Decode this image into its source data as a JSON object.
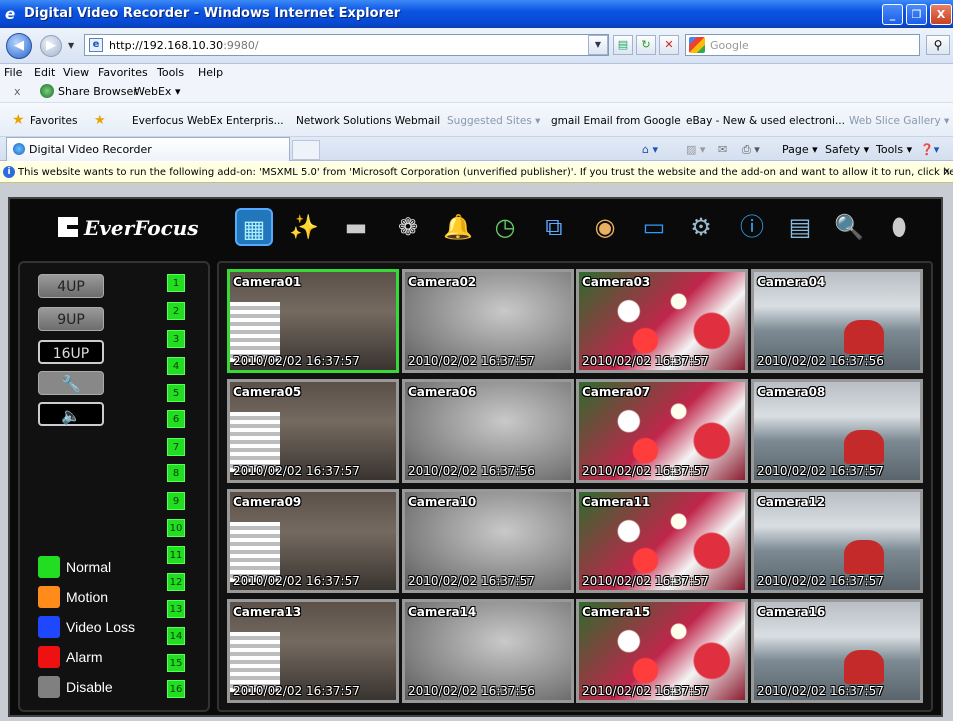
{
  "window": {
    "title": "Digital Video Recorder - Windows Internet Explorer",
    "buttons": {
      "minimize": "_",
      "maximize": "❐",
      "close": "X"
    }
  },
  "address": {
    "url_host": "http://192.168.10.30",
    "url_port": ":9980/",
    "search_placeholder": "Google"
  },
  "menu": [
    "File",
    "Edit",
    "View",
    "Favorites",
    "Tools",
    "Help"
  ],
  "linkbar": {
    "close": "x",
    "share": "Share Browser",
    "webex": "WebEx ▾"
  },
  "favorites": {
    "label": "Favorites",
    "items": [
      "Everfocus WebEx Enterpris...",
      "Network Solutions Webmail",
      "Suggested Sites ▾",
      "gmail Email from Google",
      "eBay - New & used electroni...",
      "Web Slice Gallery ▾"
    ]
  },
  "tab": {
    "label": "Digital Video Recorder"
  },
  "commands": {
    "page": "Page ▾",
    "safety": "Safety ▾",
    "tools": "Tools ▾"
  },
  "infobar": {
    "message": "This website wants to run the following add-on: 'MSXML 5.0' from 'Microsoft Corporation (unverified publisher)'. If you trust the website and the add-on and want to allow it to run, click here..."
  },
  "dvr": {
    "brand": "EverFocus",
    "toolbar_icons": [
      "live-view-icon",
      "magic-wand-icon",
      "camera-icon",
      "film-reel-icon",
      "bell-icon",
      "schedule-icon",
      "network-icon",
      "hdd-icon",
      "monitor-icon",
      "gears-icon",
      "info-icon",
      "film-strip-icon",
      "search-doc-icon",
      "ptz-dome-icon"
    ],
    "layouts": [
      "4UP",
      "9UP",
      "16UP"
    ],
    "channels": [
      "1",
      "2",
      "3",
      "4",
      "5",
      "6",
      "7",
      "8",
      "9",
      "10",
      "11",
      "12",
      "13",
      "14",
      "15",
      "16"
    ],
    "legend": [
      {
        "label": "Normal",
        "color": "#22dd22"
      },
      {
        "label": "Motion",
        "color": "#ff8c1a"
      },
      {
        "label": "Video Loss",
        "color": "#1f47ff"
      },
      {
        "label": "Alarm",
        "color": "#ee1111"
      },
      {
        "label": "Disable",
        "color": "#808080"
      }
    ],
    "cameras": [
      {
        "name": "Camera01",
        "ts": "2010/02/02  16:37:57"
      },
      {
        "name": "Camera02",
        "ts": "2010/02/02  16:37:57"
      },
      {
        "name": "Camera03",
        "ts": "2010/02/02  16:37:57"
      },
      {
        "name": "Camera04",
        "ts": "2010/02/02  16:37:56"
      },
      {
        "name": "Camera05",
        "ts": "2010/02/02  16:37:57"
      },
      {
        "name": "Camera06",
        "ts": "2010/02/02  16:37:56"
      },
      {
        "name": "Camera07",
        "ts": "2010/02/02  16:37:57"
      },
      {
        "name": "Camera08",
        "ts": "2010/02/02  16:37:57"
      },
      {
        "name": "Camera09",
        "ts": "2010/02/02  16:37:57"
      },
      {
        "name": "Camera10",
        "ts": "2010/02/02  16:37:57"
      },
      {
        "name": "Camera11",
        "ts": "2010/02/02  16:37:57"
      },
      {
        "name": "Camera12",
        "ts": "2010/02/02  16:37:57"
      },
      {
        "name": "Camera13",
        "ts": "2010/02/02  16:37:57"
      },
      {
        "name": "Camera14",
        "ts": "2010/02/02  16:37:56"
      },
      {
        "name": "Camera15",
        "ts": "2010/02/02  16:37:57"
      },
      {
        "name": "Camera16",
        "ts": "2010/02/02  16:37:57"
      }
    ]
  }
}
